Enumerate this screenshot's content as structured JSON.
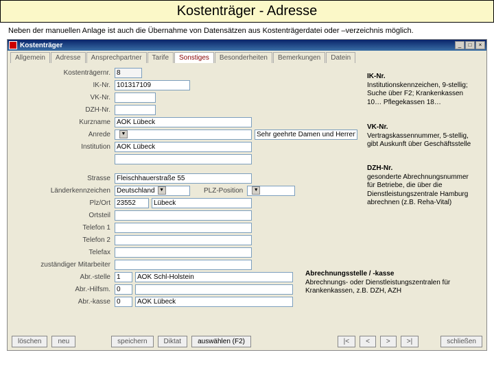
{
  "slide": {
    "title": "Kostenträger - Adresse",
    "subtitle": "Neben der manuellen Anlage ist auch die Übernahme von Datensätzen aus Kostenträgerdatei oder –verzeichnis möglich."
  },
  "window": {
    "title": "Kostenträger"
  },
  "tabs": {
    "allgemein": "Allgemein",
    "adresse": "Adresse",
    "ansprechpartner": "Ansprechpartner",
    "tarife": "Tarife",
    "sonstiges": "Sonstiges",
    "besonderheiten": "Besonderheiten",
    "bemerkungen": "Bemerkungen",
    "datein": "Datein"
  },
  "labels": {
    "kostentraegernr": "Kostenträgernr.",
    "iknr": "IK-Nr.",
    "vknr": "VK-Nr.",
    "dzhnr": "DZH-Nr.",
    "kurzname": "Kurzname",
    "anrede": "Anrede",
    "institution": "Institution",
    "strasse": "Strasse",
    "laenderkennz": "Länderkennzeichen",
    "plzposition": "PLZ-Position",
    "plzort": "Plz/Ort",
    "ortsteil": "Ortsteil",
    "telefon1": "Telefon 1",
    "telefon2": "Telefon 2",
    "telefax": "Telefax",
    "mitarbeiter": "zuständiger Mitarbeiter",
    "abrstelle": "Abr.-stelle",
    "abrhilfsm": "Abr.-Hilfsm.",
    "abrkasse": "Abr.-kasse"
  },
  "values": {
    "kostentraegernr": "8",
    "iknr": "101317109",
    "vknr": "",
    "dzhnr": "",
    "kurzname": "AOK Lübeck",
    "anrede_sel": "",
    "anrede_right": "Sehr geehrte Damen und Herren",
    "institution": "AOK Lübeck",
    "strasse": "Fleischhauerstraße 55",
    "laenderkennz": "Deutschland",
    "plz": "23552",
    "ort": "Lübeck",
    "abrstelle_num": "1",
    "abrstelle_val": "AOK Schl-Holstein",
    "abrhilfsm_num": "0",
    "abrkasse_num": "0",
    "abrkasse_val": "AOK Lübeck"
  },
  "notes": {
    "ik": {
      "h": "IK-Nr.",
      "t": "Institutionskennzeichen, 9-stellig; Suche über F2; Krankenkassen 10… Pflegekassen 18…"
    },
    "vk": {
      "h": "VK-Nr.",
      "t": "Vertragskassennummer, 5-stellig, gibt Auskunft über Geschäftsstelle"
    },
    "dzh": {
      "h": "DZH-Nr.",
      "t": "gesonderte Abrechnungsnummer für Betriebe, die über die Dienstleistungszentrale Hamburg abrechnen (z.B. Reha-Vital)"
    },
    "abr": {
      "h": "Abrechnungsstelle / -kasse",
      "t": "Abrechnungs- oder Dienstleistungszentralen für Krankenkassen, z.B. DZH, AZH"
    }
  },
  "buttons": {
    "loeschen": "löschen",
    "neu": "neu",
    "speichern": "speichern",
    "diktat": "Diktat",
    "auswaehlen": "auswählen (F2)",
    "first": "|<",
    "prev": "<",
    "next": ">",
    "last": ">|",
    "schliessen": "schließen"
  }
}
